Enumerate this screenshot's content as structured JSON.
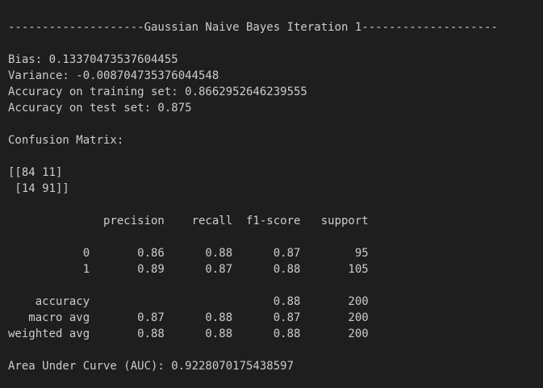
{
  "output": {
    "lines": [
      "--------------------Gaussian Naive Bayes Iteration 1--------------------",
      "",
      "Bias: 0.13370473537604455",
      "Variance: -0.008704735376044548",
      "Accuracy on training set: 0.8662952646239555",
      "Accuracy on test set: 0.875",
      "",
      "Confusion Matrix:",
      "",
      "[[84 11]",
      " [14 91]]",
      "",
      "              precision    recall  f1-score   support",
      "",
      "           0       0.86      0.88      0.87        95",
      "           1       0.89      0.87      0.88       105",
      "",
      "    accuracy                           0.88       200",
      "   macro avg       0.87      0.88      0.87       200",
      "weighted avg       0.88      0.88      0.88       200",
      "",
      "Area Under Curve (AUC): 0.9228070175438597"
    ]
  }
}
